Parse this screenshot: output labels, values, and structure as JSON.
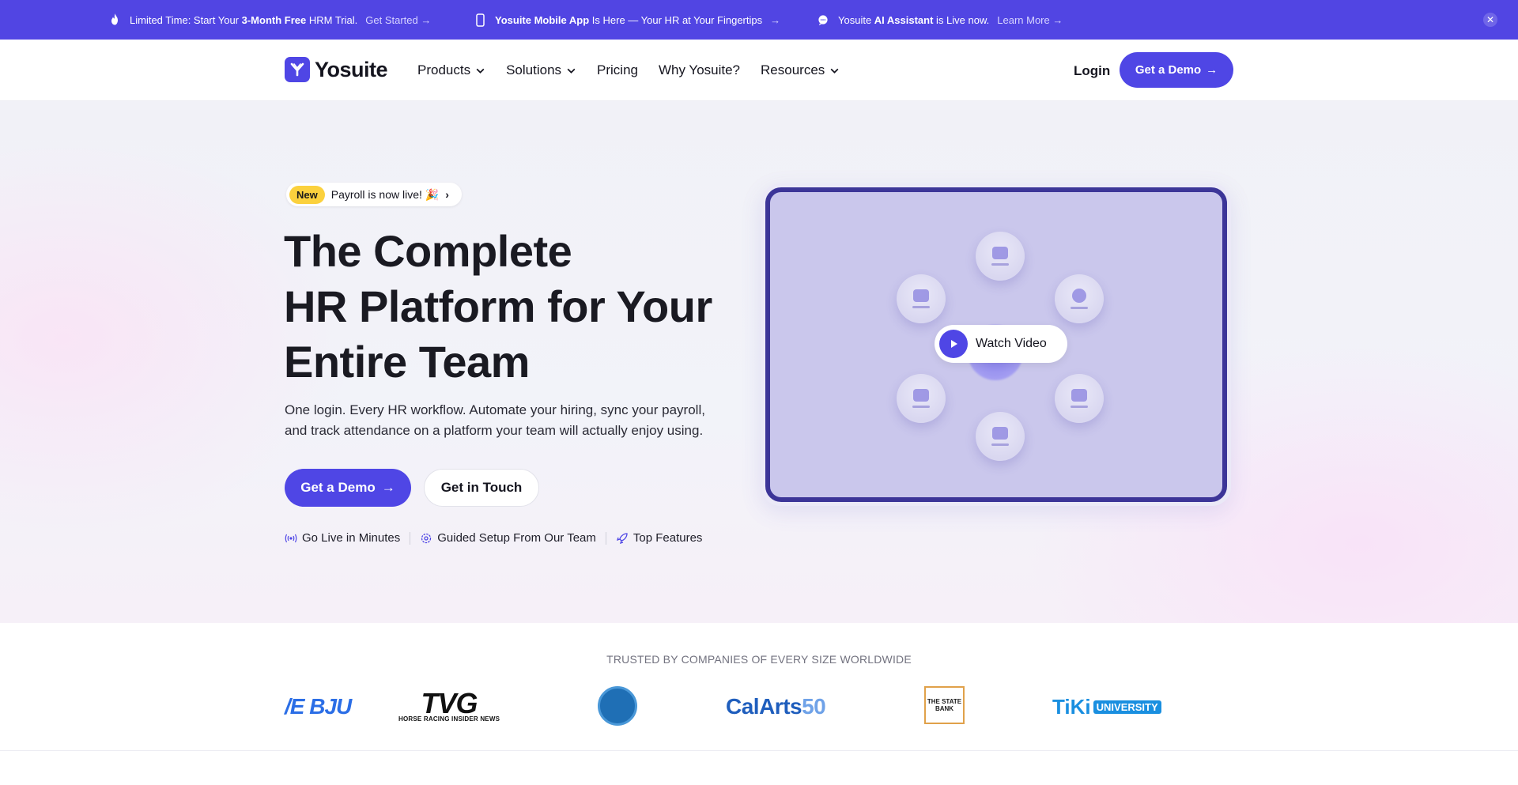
{
  "announcements": [
    {
      "prefix": "Limited Time: Start Your ",
      "bold": "3-Month Free",
      "suffix": " HRM Trial.",
      "link": "Get Started"
    },
    {
      "prefix": "",
      "bold": "Yosuite Mobile App",
      "suffix": " Is Here — Your HR at Your Fingertips",
      "link": ""
    },
    {
      "prefix": "Yosuite ",
      "bold": "AI Assistant",
      "suffix": " is Live now.",
      "link": "Learn More"
    }
  ],
  "nav": {
    "brand": "Yosuite",
    "menu": [
      "Products",
      "Solutions",
      "Pricing",
      "Why Yosuite?",
      "Resources"
    ],
    "login": "Login",
    "demo": "Get a Demo"
  },
  "hero": {
    "badge_tag": "New",
    "badge_text": "Payroll is now live! 🎉",
    "title_line1": "The Complete",
    "title_line2": "HR Platform for Your",
    "title_line3": "Entire Team",
    "subtitle": "One login. Every HR workflow. Automate your hiring, sync your payroll, and track attendance on a platform your team will actually enjoy using.",
    "cta_primary": "Get a Demo",
    "cta_secondary": "Get in Touch",
    "features": [
      "Go Live in Minutes",
      "Guided Setup From Our Team",
      "Top Features"
    ],
    "watch_video": "Watch Video"
  },
  "trusted": {
    "title": "TRUSTED BY COMPANIES OF EVERY SIZE WORLDWIDE",
    "logos": [
      "/E BJU",
      "TVG",
      "HORSE RACING INSIDER NEWS",
      "CalArts",
      "50",
      "THE STATE BANK",
      "TiKi",
      "UNIVERSITY"
    ]
  },
  "colors": {
    "brand": "#4f46e5",
    "announce_bg": "#5145e3",
    "badge_yellow": "#fbd13d"
  }
}
